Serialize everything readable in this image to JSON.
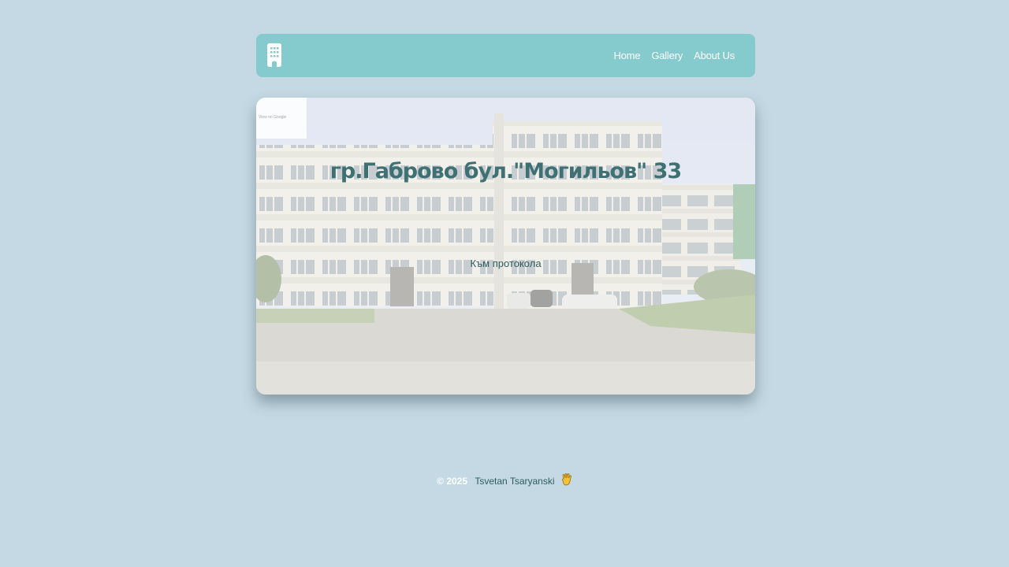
{
  "nav": {
    "brand_icon": "building-icon",
    "links": [
      {
        "label": "Home"
      },
      {
        "label": "Gallery"
      },
      {
        "label": "About Us"
      }
    ]
  },
  "hero": {
    "title": "гр.Габрово бул.\"Могильов\" 33",
    "link_label": "Към протокола",
    "map_badge_text": "View on Google"
  },
  "footer": {
    "copyright": "© 2025",
    "author": "Tsvetan Tsaryanski",
    "emoji_icon": "vulcan-salute-icon"
  },
  "colors": {
    "background": "#c4d9e3",
    "navbar": "#85cacc",
    "title": "#3f7073",
    "link": "#2f5c5e"
  }
}
